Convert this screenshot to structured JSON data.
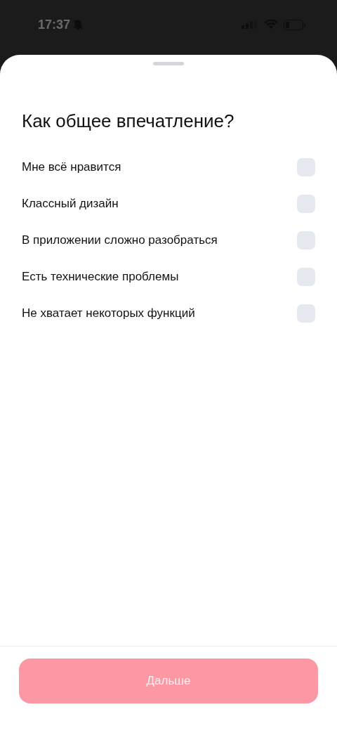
{
  "status_bar": {
    "time": "17:37",
    "silent": true
  },
  "sheet": {
    "title": "Как общее впечатление?",
    "options": [
      {
        "label": "Мне всё нравится",
        "checked": false
      },
      {
        "label": "Классный дизайн",
        "checked": false
      },
      {
        "label": "В приложении сложно разобраться",
        "checked": false
      },
      {
        "label": "Есть технические проблемы",
        "checked": false
      },
      {
        "label": "Не хватает некоторых функций",
        "checked": false
      }
    ],
    "next_button": {
      "label": "Дальше",
      "disabled": true
    }
  }
}
